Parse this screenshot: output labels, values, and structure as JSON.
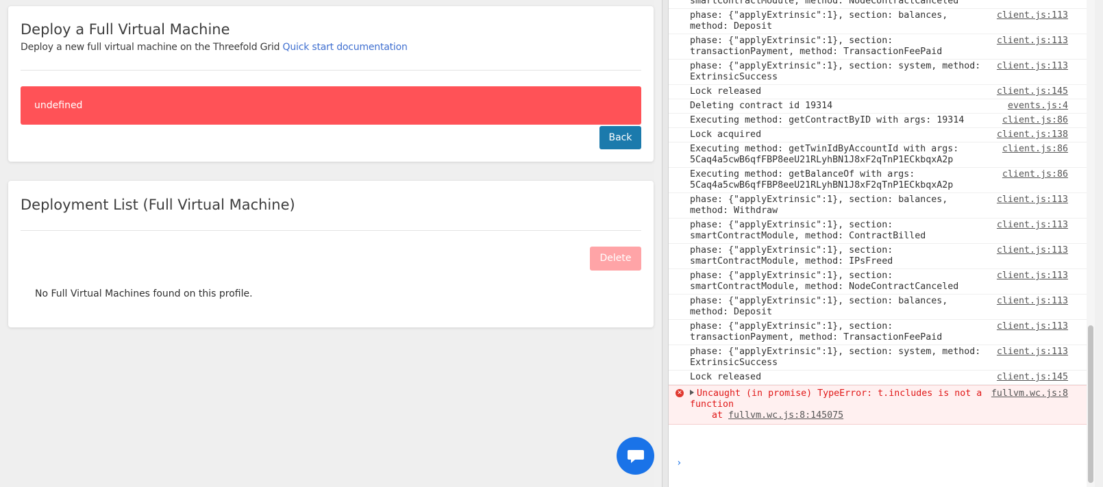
{
  "deploy_card": {
    "title": "Deploy a Full Virtual Machine",
    "subtitle": "Deploy a new full virtual machine on the Threefold Grid",
    "docs_link": "Quick start documentation",
    "error_message": "undefined",
    "back_label": "Back"
  },
  "list_card": {
    "title": "Deployment List (Full Virtual Machine)",
    "delete_label": "Delete",
    "empty_message": "No Full Virtual Machines found on this profile."
  },
  "console": {
    "lines": [
      {
        "text": "smartContractModule, method: NodeContractCanceled",
        "src": ""
      },
      {
        "text": "phase: {\"applyExtrinsic\":1}, section: balances, method: Deposit",
        "src": "client.js:113"
      },
      {
        "text": "phase: {\"applyExtrinsic\":1}, section: transactionPayment, method: TransactionFeePaid",
        "src": "client.js:113"
      },
      {
        "text": "phase: {\"applyExtrinsic\":1}, section: system, method: ExtrinsicSuccess",
        "src": "client.js:113"
      },
      {
        "text": "Lock released",
        "src": "client.js:145"
      },
      {
        "text": "Deleting contract id 19314",
        "src": "events.js:4"
      },
      {
        "text": "Executing method: getContractByID with args: 19314",
        "src": "client.js:86"
      },
      {
        "text": "Lock acquired",
        "src": "client.js:138"
      },
      {
        "text": "Executing method: getTwinIdByAccountId with args: 5Caq4a5cwB6qfFBP8eeU21RLyhBN1J8xF2qTnP1ECkbqxA2p",
        "src": "client.js:86"
      },
      {
        "text": "Executing method: getBalanceOf with args: 5Caq4a5cwB6qfFBP8eeU21RLyhBN1J8xF2qTnP1ECkbqxA2p",
        "src": "client.js:86"
      },
      {
        "text": "phase: {\"applyExtrinsic\":1}, section: balances, method: Withdraw",
        "src": "client.js:113"
      },
      {
        "text": "phase: {\"applyExtrinsic\":1}, section: smartContractModule, method: ContractBilled",
        "src": "client.js:113"
      },
      {
        "text": "phase: {\"applyExtrinsic\":1}, section: smartContractModule, method: IPsFreed",
        "src": "client.js:113"
      },
      {
        "text": "phase: {\"applyExtrinsic\":1}, section: smartContractModule, method: NodeContractCanceled",
        "src": "client.js:113"
      },
      {
        "text": "phase: {\"applyExtrinsic\":1}, section: balances, method: Deposit",
        "src": "client.js:113"
      },
      {
        "text": "phase: {\"applyExtrinsic\":1}, section: transactionPayment, method: TransactionFeePaid",
        "src": "client.js:113"
      },
      {
        "text": "phase: {\"applyExtrinsic\":1}, section: system, method: ExtrinsicSuccess",
        "src": "client.js:113"
      },
      {
        "text": "Lock released",
        "src": "client.js:145"
      }
    ],
    "error": {
      "text": "Uncaught (in promise) TypeError: t.includes is not a function",
      "src": "fullvm.wc.js:8",
      "stack_prefix": "at",
      "stack_link": "fullvm.wc.js:8:145075"
    },
    "prompt": "›"
  },
  "icons": {
    "chat": "chat-bubble-icon",
    "error": "error-circle-icon",
    "expand": "expand-triangle-icon"
  },
  "colors": {
    "error_box": "#ff5257",
    "back_button": "#1b7aac",
    "delete_button": "#ffa4a7",
    "link": "#3f6fd0",
    "chat_fab": "#1a73e8",
    "console_error": "#e01616"
  }
}
